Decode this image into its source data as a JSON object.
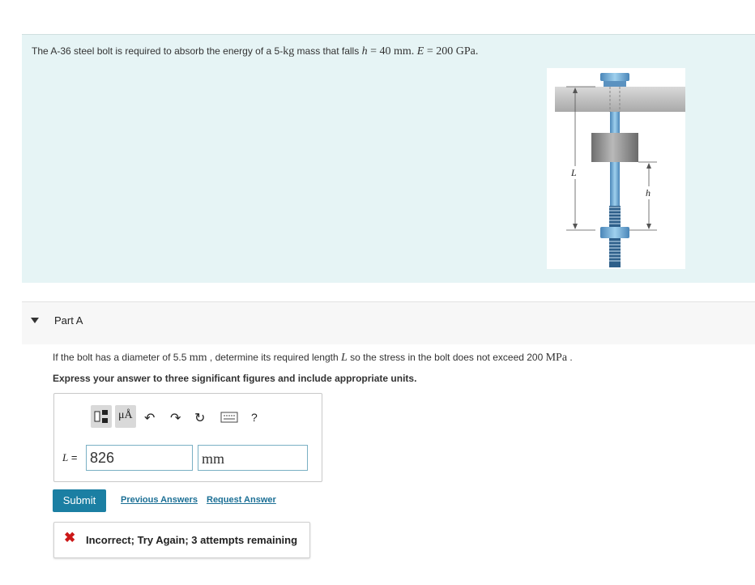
{
  "problem": {
    "text_prefix": "The A-36 steel bolt is required to absorb the energy of a 5-",
    "mass_unit": "kg",
    "text_mid": " mass that falls ",
    "h_symbol": "h",
    "h_expr": " = 40 mm",
    "sep": ". ",
    "E_symbol": "E",
    "E_expr": " = 200 GPa",
    "end": "."
  },
  "figure": {
    "label_L": "L",
    "label_h": "h"
  },
  "part": {
    "title": "Part A",
    "question_prefix": "If the bolt has a diameter of 5.5 ",
    "diam_unit": "mm",
    "question_mid": " , determine its required length ",
    "L_symbol": "L",
    "question_mid2": " so the stress in the bolt does not exceed 200 ",
    "stress_unit": "MPa",
    "question_end": " .",
    "instruction": "Express your answer to three significant figures and include appropriate units."
  },
  "answer": {
    "label_symbol": "L",
    "label_eq": " = ",
    "value": "826",
    "unit": "mm"
  },
  "toolbar": {
    "units_label": "μÅ",
    "help_label": "?"
  },
  "actions": {
    "submit": "Submit",
    "previous_answers": "Previous Answers",
    "request_answer": "Request Answer"
  },
  "feedback": {
    "icon": "✖",
    "text": "Incorrect; Try Again; 3 attempts remaining"
  },
  "colors": {
    "panel_bg": "#e6f4f5",
    "submit_bg": "#1b7fa3",
    "error": "#cc1818",
    "link": "#1b6f95"
  }
}
